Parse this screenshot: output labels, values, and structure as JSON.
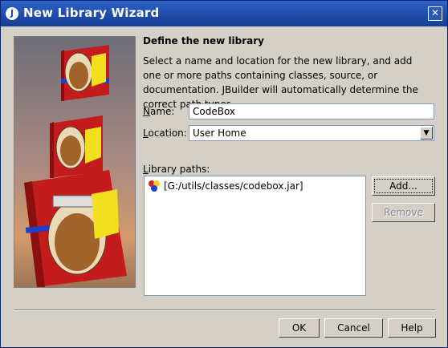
{
  "window": {
    "title": "New Library Wizard",
    "title_icon": "J"
  },
  "section": {
    "heading": "Define the new library",
    "description": "Select a name and location for the new library, and add one or more paths containing classes, source, or documentation. JBuilder will automatically determine the correct path types."
  },
  "name_field": {
    "label_prefix": "N",
    "label_rest": "ame:",
    "value": "CodeBox"
  },
  "location_field": {
    "label_prefix": "L",
    "label_rest": "ocation:",
    "value": "User Home"
  },
  "library_paths": {
    "label_prefix": "L",
    "label_rest": "ibrary paths:",
    "items": [
      {
        "text": "[G:/utils/classes/codebox.jar]",
        "icon": "library-icon"
      }
    ]
  },
  "buttons": {
    "add": "Add...",
    "remove": "Remove",
    "ok": "OK",
    "cancel": "Cancel",
    "help": "Help"
  },
  "colors": {
    "titlebar": "#1c4aa8",
    "dialog_bg": "#d4d0c8"
  }
}
